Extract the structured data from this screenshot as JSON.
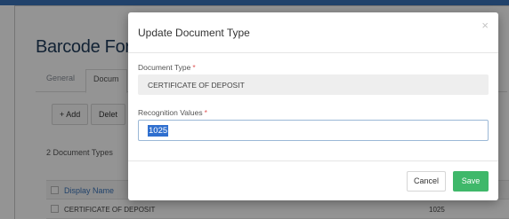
{
  "background": {
    "page_title": "Barcode Format",
    "tabs": {
      "general": "General",
      "active": "Docum"
    },
    "toolbar": {
      "add_label": "+ Add",
      "delete_label": "Delet"
    },
    "count_label": "2 Document Types",
    "table": {
      "header_display_name": "Display Name",
      "rows": [
        {
          "display_name": "CERTIFICATE OF DEPOSIT",
          "value": "1025"
        }
      ]
    }
  },
  "modal": {
    "title": "Update Document Type",
    "close_glyph": "×",
    "document_type": {
      "label": "Document Type",
      "required_mark": "*",
      "value": "CERTIFICATE OF DEPOSIT"
    },
    "recognition_values": {
      "label": "Recognition Values",
      "required_mark": "*",
      "value": "1025"
    },
    "cancel_label": "Cancel",
    "save_label": "Save"
  },
  "colors": {
    "save_button": "#3fb86a",
    "selection_highlight": "#2f6fcf",
    "required_mark": "#e05555",
    "link_blue": "#3a73b8"
  }
}
